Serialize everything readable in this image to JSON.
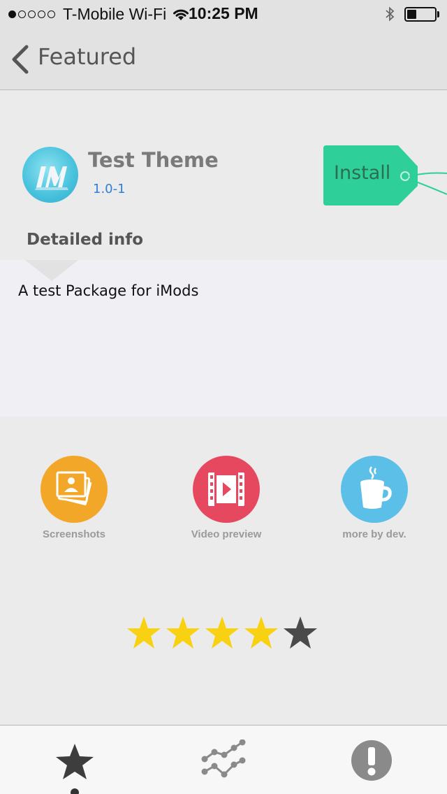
{
  "status_bar": {
    "carrier": "T-Mobile Wi-Fi",
    "time": "10:25 PM",
    "signal_bars_filled": 1,
    "signal_bars_total": 5,
    "battery_level": 0.35
  },
  "nav": {
    "back_label": "Featured"
  },
  "package": {
    "name": "Test Theme",
    "version": "1.0-1",
    "install_label": "Install",
    "install_color": "#2fcf9a"
  },
  "details": {
    "title": "Detailed info",
    "description": "A test Package for iMods"
  },
  "actions": [
    {
      "label": "Screenshots",
      "icon": "photos-icon",
      "color": "#f3a728"
    },
    {
      "label": "Video preview",
      "icon": "film-icon",
      "color": "#e5485f"
    },
    {
      "label": "more by dev.",
      "icon": "coffee-cup-icon",
      "color": "#5bbfe8"
    }
  ],
  "rating": {
    "value": 4,
    "max": 5,
    "filled_color": "#f9d113",
    "empty_color": "#4a4a4a"
  },
  "tabs": [
    {
      "icon": "star-icon",
      "selected": true
    },
    {
      "icon": "trending-icon",
      "selected": false
    },
    {
      "icon": "exclamation-icon",
      "selected": false
    }
  ]
}
